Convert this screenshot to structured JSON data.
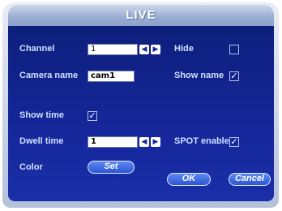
{
  "window": {
    "title": "LIVE"
  },
  "channel": {
    "label": "Channel",
    "value": "1"
  },
  "hide": {
    "label": "Hide",
    "checked": false
  },
  "camera_name": {
    "label": "Camera name",
    "value": "cam1"
  },
  "show_name": {
    "label": "Show name",
    "checked": true
  },
  "show_time": {
    "label": "Show time",
    "checked": true
  },
  "dwell_time": {
    "label": "Dwell time",
    "value": "1"
  },
  "spot_enable": {
    "label": "SPOT enable",
    "checked": true
  },
  "color": {
    "label": "Color",
    "button": "Set"
  },
  "buttons": {
    "ok": "OK",
    "cancel": "Cancel"
  },
  "icons": {
    "prev": "triangle-left-icon",
    "next": "triangle-right-icon",
    "check": "checkmark-icon"
  },
  "colors": {
    "panel": "#15279a",
    "label": "#cfe0ff",
    "button": "#2a55d6"
  }
}
